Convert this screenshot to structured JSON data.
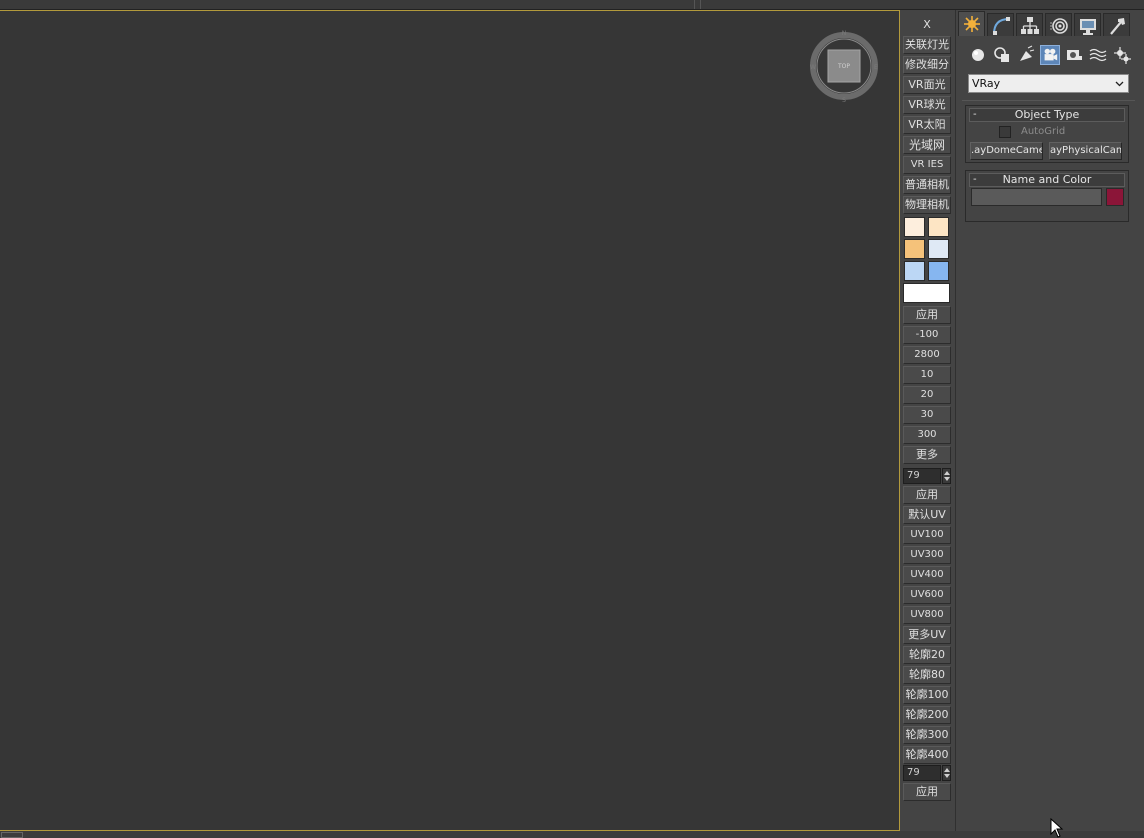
{
  "colors": {
    "viewport_bg": "#363636",
    "viewport_border": "#b39a3c",
    "active_subicon": "#5d86b8",
    "object_color": "#8b1538"
  },
  "toolbar": {
    "close_label": "X",
    "buttons_top": [
      "关联灯光",
      "修改细分",
      "VR面光",
      "VR球光",
      "VR太阳",
      "光域网",
      "VR IES",
      "普通相机",
      "物理相机"
    ],
    "swatches": [
      "#fdeedd",
      "#fde5c4",
      "#f5c27a",
      "#dfe9f5",
      "#bcd7f5",
      "#86b6f0"
    ],
    "swatch_wide": "#ffffff",
    "apply_label_1": "应用",
    "temps": [
      "-100",
      "2800",
      "10",
      "20",
      "30",
      "300"
    ],
    "more_label": "更多",
    "spinner_1": "79",
    "apply_label_2": "应用",
    "uv_buttons": [
      "默认UV",
      "UV100",
      "UV300",
      "UV400",
      "UV600",
      "UV800",
      "更多UV"
    ],
    "outline_buttons": [
      "轮廓20",
      "轮廓80",
      "轮廓100",
      "轮廓200",
      "轮廓300",
      "轮廓400"
    ],
    "spinner_2": "79",
    "apply_label_3": "应用"
  },
  "viewcube": {
    "face_label": "TOP"
  },
  "command_panel": {
    "tabs": [
      "create-icon",
      "modify-icon",
      "hierarchy-icon",
      "motion-icon",
      "display-icon",
      "utilities-icon"
    ],
    "sub_icons": [
      "geometry-icon",
      "shapes-icon",
      "lights-icon",
      "cameras-icon",
      "helpers-icon",
      "spacewarps-icon",
      "systems-icon"
    ],
    "category_value": "VRay",
    "object_type": {
      "title": "Object Type",
      "minus": "-",
      "autogrid_label": "AutoGrid",
      "buttons": [
        ".ayDomeCame",
        "ayPhysicalCam"
      ]
    },
    "name_and_color": {
      "title": "Name and Color",
      "minus": "-",
      "name_value": ""
    }
  }
}
